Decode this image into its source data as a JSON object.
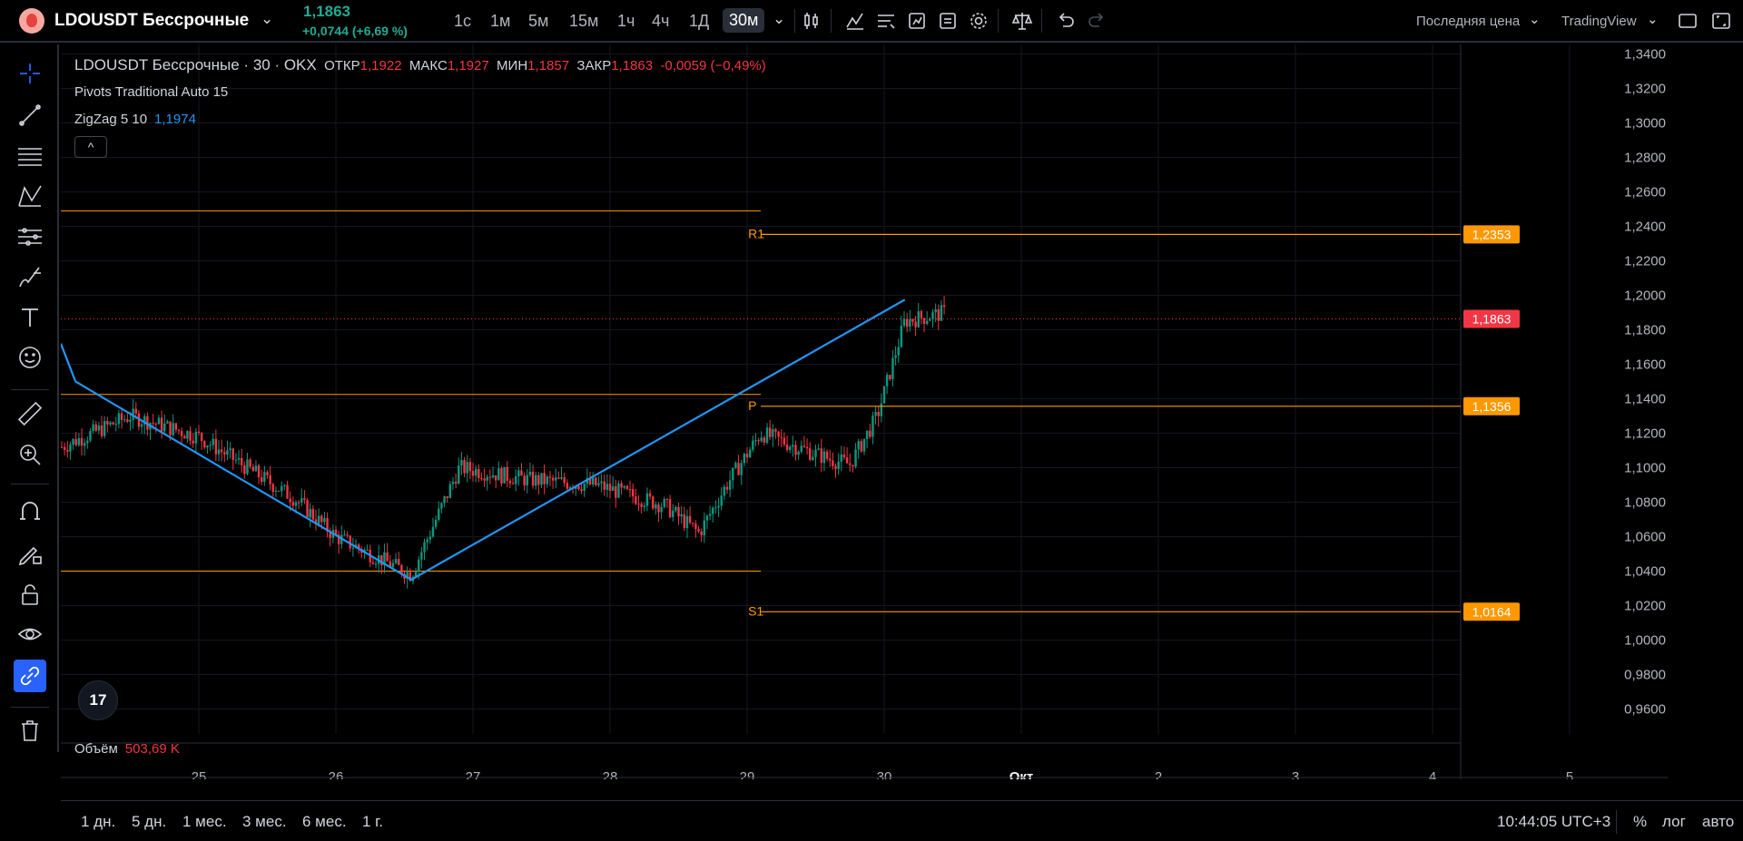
{
  "header": {
    "symbol": "LDOUSDT Бессрочные",
    "price": "1,1863",
    "change": "+0,0744 (+6,69 %)",
    "intervals": [
      "1с",
      "1м",
      "5м",
      "15м",
      "1ч",
      "4ч",
      "1Д",
      "30м"
    ],
    "active_interval": "30м",
    "price_type": "Последняя цена",
    "source": "TradingView",
    "icons": [
      "bar-style-icon",
      "indicators-icon",
      "templates-icon",
      "alert-icon",
      "replay-icon",
      "settings-icon",
      "compare-icon",
      "undo-icon",
      "redo-icon",
      "fullscreen-icon",
      "screenshot-icon"
    ]
  },
  "left_toolbar": {
    "icons": [
      "crosshair-icon",
      "trendline-icon",
      "fib-icon",
      "pattern-icon",
      "forecast-icon",
      "brush-icon",
      "text-icon",
      "emoji-icon",
      "ruler-icon",
      "zoom-in-icon",
      "magnet-icon",
      "lock-draw-icon",
      "lock-icon",
      "eye-icon",
      "link-icon",
      "trash-icon"
    ]
  },
  "legend": {
    "symbol_line": "LDOUSDT Бессрочные · 30 · OKX",
    "open_label": "ОТКР",
    "open": "1,1922",
    "high_label": "МАКС",
    "high": "1,1927",
    "low_label": "МИН",
    "low": "1,1857",
    "close_label": "ЗАКР",
    "close": "1,1863",
    "change": "-0,0059 (−0,49%)",
    "pivots": "Pivots Traditional Auto 15",
    "zigzag": "ZigZag 5 10",
    "zigzag_value": "1,1974",
    "collapse": "^"
  },
  "volume": {
    "label": "Объём",
    "value": "503,69 K"
  },
  "badge": "17",
  "chart_data": {
    "type": "candlestick",
    "y_axis": {
      "ticks": [
        "1,3400",
        "1,3200",
        "1,3000",
        "1,2800",
        "1,2600",
        "1,2400",
        "1,2200",
        "1,2000",
        "1,1800",
        "1,1600",
        "1,1400",
        "1,1200",
        "1,1000",
        "1,0800",
        "1,0600",
        "1,0400",
        "1,0200",
        "1,0000",
        "0,9800",
        "0,9600"
      ],
      "range": [
        0.9455,
        1.3455
      ]
    },
    "x_axis": {
      "ticks": [
        "25",
        "26",
        "27",
        "28",
        "29",
        "30",
        "Окт",
        "2",
        "3",
        "4",
        "5"
      ]
    },
    "last_price": "1,1863",
    "pivot_levels": [
      {
        "label": "R1",
        "value": "1,2353",
        "color": "#ff9800"
      },
      {
        "label": "P",
        "value": "1,1356",
        "color": "#ff9800"
      },
      {
        "label": "S1",
        "value": "1,0164",
        "color": "#ff9800"
      }
    ],
    "zigzag_points": [
      [
        24.1,
        1.15
      ],
      [
        26.55,
        1.035
      ],
      [
        30.15,
        1.1974
      ]
    ],
    "prev_pivot_levels": [
      1.249,
      1.1425,
      1.04
    ],
    "up_color": "#089981",
    "down_color": "#f23645",
    "zigzag_color": "#2196f3"
  },
  "bottom": {
    "ranges": [
      "1 дн.",
      "5 дн.",
      "1 мес.",
      "3 мес.",
      "6 мес.",
      "1 г."
    ],
    "time": "10:44:05 UTC+3",
    "percent": "%",
    "log": "лог",
    "auto": "авто"
  }
}
